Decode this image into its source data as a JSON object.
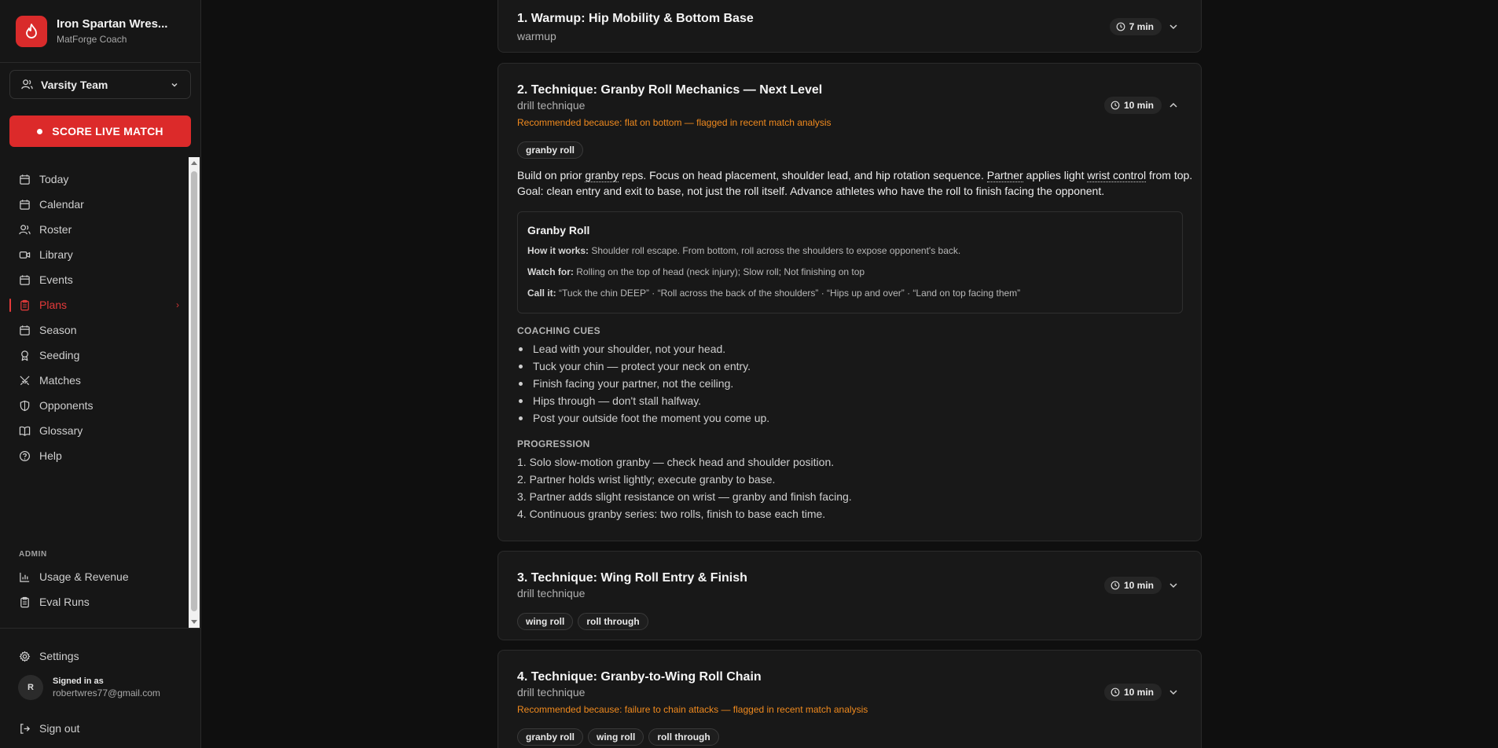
{
  "brand": {
    "name": "Iron Spartan Wres...",
    "subtitle": "MatForge Coach"
  },
  "team_select": {
    "value": "Varsity Team"
  },
  "score_button": {
    "label": "SCORE LIVE MATCH"
  },
  "nav": {
    "items": [
      {
        "label": "Today",
        "icon": "calendar-icon"
      },
      {
        "label": "Calendar",
        "icon": "calendar-icon"
      },
      {
        "label": "Roster",
        "icon": "users-icon"
      },
      {
        "label": "Library",
        "icon": "video-icon"
      },
      {
        "label": "Events",
        "icon": "calendar-icon"
      },
      {
        "label": "Plans",
        "icon": "clipboard-icon",
        "active": true
      },
      {
        "label": "Season",
        "icon": "calendar-icon"
      },
      {
        "label": "Seeding",
        "icon": "award-icon"
      },
      {
        "label": "Matches",
        "icon": "swords-icon"
      },
      {
        "label": "Opponents",
        "icon": "shield-icon"
      },
      {
        "label": "Glossary",
        "icon": "book-icon"
      },
      {
        "label": "Help",
        "icon": "help-circle-icon"
      }
    ],
    "admin_label": "ADMIN",
    "admin_items": [
      {
        "label": "Usage & Revenue",
        "icon": "bar-chart-icon"
      },
      {
        "label": "Eval Runs",
        "icon": "clipboard-icon"
      }
    ]
  },
  "footer": {
    "settings_label": "Settings",
    "avatar_initial": "R",
    "signed_in_label": "Signed in as",
    "email": "robertwres77@gmail.com",
    "sign_out_label": "Sign out"
  },
  "plan": {
    "items": [
      {
        "title": "1. Warmup: Hip Mobility & Bottom Base",
        "type": "warmup",
        "duration": "7 min",
        "expanded": false
      },
      {
        "title": "2. Technique: Granby Roll Mechanics — Next Level",
        "type": "drill technique",
        "reason": "Recommended because: flat on bottom — flagged in recent match analysis",
        "duration": "10 min",
        "expanded": true,
        "tags": [
          "granby roll"
        ],
        "description": {
          "p1": "Build on prior ",
          "t1": "granby",
          "p2": " reps. Focus on head placement, shoulder lead, and hip rotation sequence. ",
          "t2": "Partner",
          "p3": " applies light ",
          "t3": "wrist control",
          "p4": " from top. Goal: clean entry and exit to base, not just the roll itself. Advance athletes who have the roll to finish facing the opponent."
        },
        "technique": {
          "name": "Granby Roll",
          "how_label": "How it works:",
          "how": "Shoulder roll escape. From bottom, roll across the shoulders to expose opponent's back.",
          "watch_label": "Watch for:",
          "watch": "Rolling on the top of head (neck injury); Slow roll; Not finishing on top",
          "call_label": "Call it:",
          "call": "“Tuck the chin DEEP” · “Roll across the back of the shoulders” · “Hips up and over” · “Land on top facing them”"
        },
        "cues_label": "COACHING CUES",
        "cues": [
          "Lead with your shoulder, not your head.",
          "Tuck your chin — protect your neck on entry.",
          "Finish facing your partner, not the ceiling.",
          "Hips through — don't stall halfway.",
          "Post your outside foot the moment you come up."
        ],
        "progression_label": "PROGRESSION",
        "progression": [
          "1. Solo slow-motion granby — check head and shoulder position.",
          "2. Partner holds wrist lightly; execute granby to base.",
          "3. Partner adds slight resistance on wrist — granby and finish facing.",
          "4. Continuous granby series: two rolls, finish to base each time."
        ]
      },
      {
        "title": "3. Technique: Wing Roll Entry & Finish",
        "type": "drill technique",
        "duration": "10 min",
        "expanded": false,
        "tags": [
          "wing roll",
          "roll through"
        ]
      },
      {
        "title": "4. Technique: Granby-to-Wing Roll Chain",
        "type": "drill technique",
        "reason": "Recommended because: failure to chain attacks — flagged in recent match analysis",
        "duration": "10 min",
        "expanded": false,
        "tags": [
          "granby roll",
          "wing roll",
          "roll through"
        ]
      }
    ]
  },
  "colors": {
    "accent": "#dc2a2a",
    "reason": "#f08a1e",
    "background": "#0f0f0f",
    "card": "#181818"
  }
}
